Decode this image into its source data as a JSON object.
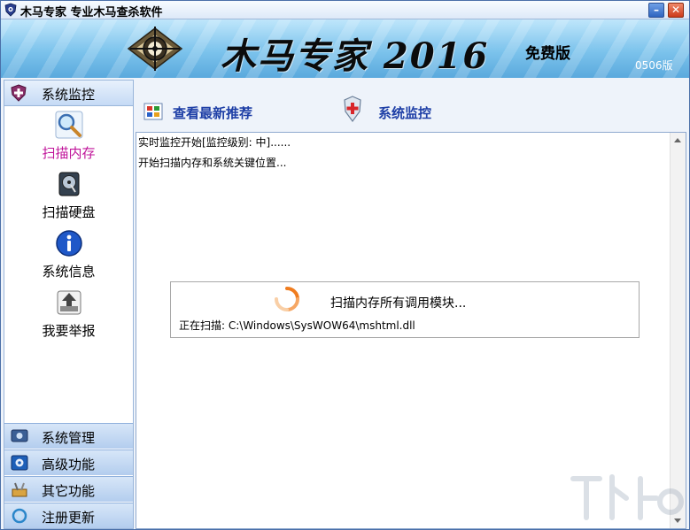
{
  "window": {
    "title": "木马专家 专业木马查杀软件",
    "minimize_glyph": "–",
    "close_glyph": "✕"
  },
  "banner": {
    "title": "木马专家 2016",
    "badge": "免费版",
    "version": "0506版"
  },
  "sidebar": {
    "header": {
      "label": "系统监控",
      "icon": "shield-plus-icon"
    },
    "tools": [
      {
        "label": "扫描内存",
        "icon": "magnifier-icon",
        "active": true
      },
      {
        "label": "扫描硬盘",
        "icon": "harddisk-icon",
        "active": false
      },
      {
        "label": "系统信息",
        "icon": "info-icon",
        "active": false
      },
      {
        "label": "我要举报",
        "icon": "report-upload-icon",
        "active": false
      }
    ],
    "bottom_items": [
      {
        "label": "系统管理",
        "icon": "system-manage-icon"
      },
      {
        "label": "高级功能",
        "icon": "gear-icon"
      },
      {
        "label": "其它功能",
        "icon": "tools-icon"
      },
      {
        "label": "注册更新",
        "icon": "refresh-icon"
      }
    ]
  },
  "main": {
    "toolbar": {
      "recommend_label": "查看最新推荐",
      "monitor_label": "系统监控"
    },
    "log_lines": [
      "实时监控开始[监控级别: 中]......",
      "开始扫描内存和系统关键位置..."
    ],
    "progress": {
      "title": "扫描内存所有调用模块...",
      "file": "正在扫描: C:\\Windows\\SysWOW64\\mshtml.dll"
    }
  },
  "colors": {
    "accent_link": "#1e3fa6",
    "active_tool": "#c0149a",
    "banner_blue": "#7cc3ec",
    "spinner_orange": "#f07c1e"
  }
}
